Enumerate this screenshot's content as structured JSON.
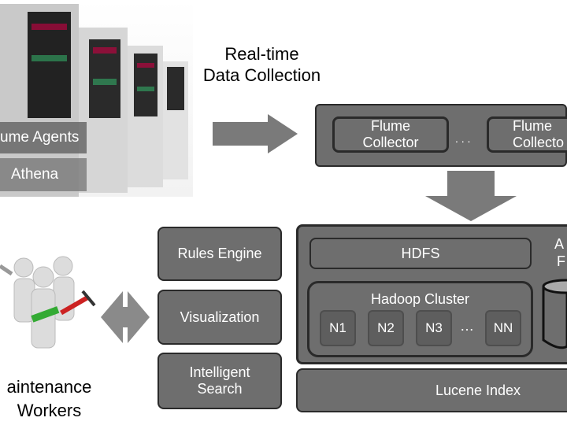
{
  "source": {
    "agents_label": "ume Agents",
    "athena_label": "Athena"
  },
  "flow_label": [
    "Real-time",
    "Data Collection"
  ],
  "collectors": {
    "items": [
      "Flume Collector",
      "Flume Collecto"
    ],
    "ellipsis": ". . ."
  },
  "storage": {
    "hdfs": "HDFS",
    "cluster_title": "Hadoop Cluster",
    "nodes": [
      "N1",
      "N2",
      "N3",
      "NN"
    ],
    "node_ellipsis": "…",
    "side_label": [
      "A",
      "F"
    ],
    "lucene": "Lucene Index"
  },
  "services": [
    "Rules Engine",
    "Visualization",
    "Intelligent Search"
  ],
  "users": {
    "label": [
      "aintenance",
      "Workers"
    ]
  },
  "colors": {
    "box": "#6e6e6e",
    "border": "#2a2a2a",
    "arrow": "#7a7a7a"
  }
}
